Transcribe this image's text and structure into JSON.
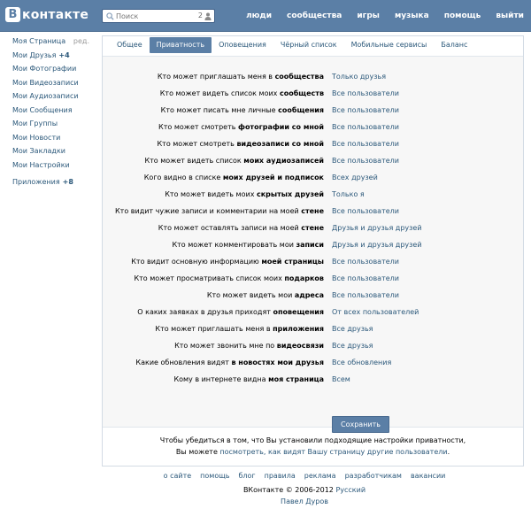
{
  "header": {
    "logo_letter": "В",
    "logo_text": "контакте",
    "search_placeholder": "Поиск",
    "search_count": "2",
    "nav": [
      "люди",
      "сообщества",
      "игры",
      "музыка",
      "помощь",
      "выйти"
    ]
  },
  "sidebar": {
    "items": [
      {
        "label": "Моя Страница",
        "count": "",
        "edit": "ред."
      },
      {
        "label": "Мои Друзья",
        "count": "+4",
        "edit": ""
      },
      {
        "label": "Мои Фотографии",
        "count": "",
        "edit": ""
      },
      {
        "label": "Мои Видеозаписи",
        "count": "",
        "edit": ""
      },
      {
        "label": "Мои Аудиозаписи",
        "count": "",
        "edit": ""
      },
      {
        "label": "Мои Сообщения",
        "count": "",
        "edit": ""
      },
      {
        "label": "Мои Группы",
        "count": "",
        "edit": ""
      },
      {
        "label": "Мои Новости",
        "count": "",
        "edit": ""
      },
      {
        "label": "Мои Закладки",
        "count": "",
        "edit": ""
      },
      {
        "label": "Мои Настройки",
        "count": "",
        "edit": ""
      }
    ],
    "apps": {
      "label": "Приложения",
      "count": "+8"
    }
  },
  "tabs": [
    "Общее",
    "Приватность",
    "Оповещения",
    "Чёрный список",
    "Мобильные сервисы",
    "Баланс"
  ],
  "active_tab": "Приватность",
  "settings": [
    {
      "pre": "Кто может приглашать меня в ",
      "bold": "сообщества",
      "post": "",
      "value": "Только друзья"
    },
    {
      "pre": "Кто может видеть список моих ",
      "bold": "сообществ",
      "post": "",
      "value": "Все пользователи"
    },
    {
      "pre": "Кто может писать мне личные ",
      "bold": "сообщения",
      "post": "",
      "value": "Все пользователи"
    },
    {
      "pre": "Кто может смотреть ",
      "bold": "фотографии со мной",
      "post": "",
      "value": "Все пользователи"
    },
    {
      "pre": "Кто может смотреть ",
      "bold": "видеозаписи со мной",
      "post": "",
      "value": "Все пользователи"
    },
    {
      "pre": "Кто может видеть список ",
      "bold": "моих аудиозаписей",
      "post": "",
      "value": "Все пользователи"
    },
    {
      "pre": "Кого видно в списке ",
      "bold": "моих друзей и подписок",
      "post": "",
      "value": "Всех друзей"
    },
    {
      "pre": "Кто может видеть моих ",
      "bold": "скрытых друзей",
      "post": "",
      "value": "Только я"
    },
    {
      "pre": "Кто видит чужие записи и комментарии на моей ",
      "bold": "стене",
      "post": "",
      "value": "Все пользователи"
    },
    {
      "pre": "Кто может оставлять записи на моей ",
      "bold": "стене",
      "post": "",
      "value": "Друзья и друзья друзей"
    },
    {
      "pre": "Кто может комментировать мои ",
      "bold": "записи",
      "post": "",
      "value": "Друзья и друзья друзей"
    },
    {
      "pre": "Кто видит основную информацию ",
      "bold": "моей страницы",
      "post": "",
      "value": "Все пользователи"
    },
    {
      "pre": "Кто может просматривать список моих ",
      "bold": "подарков",
      "post": "",
      "value": "Все пользователи"
    },
    {
      "pre": "Кто может видеть мои ",
      "bold": "адреса",
      "post": "",
      "value": "Все пользователи"
    },
    {
      "pre": "О каких заявках в друзья приходят ",
      "bold": "оповещения",
      "post": "",
      "value": "От всех пользователей"
    },
    {
      "pre": "Кто может приглашать меня в ",
      "bold": "приложения",
      "post": "",
      "value": "Все друзья"
    },
    {
      "pre": "Кто может звонить мне по ",
      "bold": "видеосвязи",
      "post": "",
      "value": "Все друзья"
    },
    {
      "pre": "Какие обновления видят ",
      "bold": "в новостях мои друзья",
      "post": "",
      "value": "Все обновления"
    },
    {
      "pre": "Кому в интернете видна ",
      "bold": "моя страница",
      "post": "",
      "value": "Всем"
    }
  ],
  "save_label": "Сохранить",
  "note": {
    "line1": "Чтобы убедиться в том, что Вы установили подходящие настройки приватности,",
    "line2_pre": "Вы можете ",
    "line2_link": "посмотреть, как видят Вашу страницу другие пользователи",
    "line2_post": "."
  },
  "footer": {
    "links": [
      "о сайте",
      "помощь",
      "блог",
      "правила",
      "реклама",
      "разработчикам",
      "вакансии"
    ],
    "copyright": "ВКонтакте © 2006-2012",
    "language": "Русский",
    "author": "Павел Дуров"
  },
  "colors": {
    "brand": "#5b7fa6",
    "link": "#2b587a",
    "panel_bg": "#f7f7f7"
  }
}
